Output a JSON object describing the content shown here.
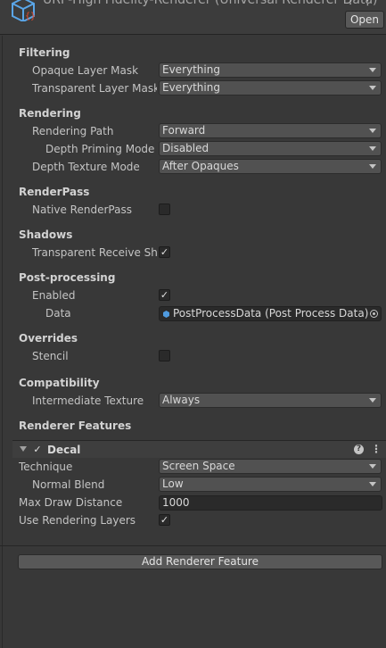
{
  "header": {
    "title": "URP-High Fidelity-Renderer (Universal Renderer Data)",
    "open_label": "Open",
    "help_glyph": "?",
    "menu_glyph": "⋮",
    "icon": "urp-asset-icon"
  },
  "filtering": {
    "section": "Filtering",
    "opaque_label": "Opaque Layer Mask",
    "opaque_value": "Everything",
    "transparent_label": "Transparent Layer Mask",
    "transparent_value": "Everything"
  },
  "rendering": {
    "section": "Rendering",
    "path_label": "Rendering Path",
    "path_value": "Forward",
    "depth_priming_label": "Depth Priming Mode",
    "depth_priming_value": "Disabled",
    "depth_texture_label": "Depth Texture Mode",
    "depth_texture_value": "After Opaques"
  },
  "renderpass": {
    "section": "RenderPass",
    "native_label": "Native RenderPass",
    "native_checked": false
  },
  "shadows": {
    "section": "Shadows",
    "transparent_label": "Transparent Receive Shadows",
    "transparent_checked": true
  },
  "postprocessing": {
    "section": "Post-processing",
    "enabled_label": "Enabled",
    "enabled_checked": true,
    "data_label": "Data",
    "data_value": "PostProcessData (Post Process Data)"
  },
  "overrides": {
    "section": "Overrides",
    "stencil_label": "Stencil",
    "stencil_checked": false
  },
  "compatibility": {
    "section": "Compatibility",
    "intermediate_label": "Intermediate Texture",
    "intermediate_value": "Always"
  },
  "renderer_features": {
    "section": "Renderer Features",
    "decal": {
      "name": "Decal",
      "enabled": true,
      "technique_label": "Technique",
      "technique_value": "Screen Space",
      "normal_blend_label": "Normal Blend",
      "normal_blend_value": "Low",
      "max_draw_label": "Max Draw Distance",
      "max_draw_value": "1000",
      "rendering_layers_label": "Use Rendering Layers",
      "rendering_layers_checked": true
    },
    "add_label": "Add Renderer Feature"
  },
  "glyphs": {
    "check": "✓",
    "help": "?",
    "kebab": "⋮"
  }
}
